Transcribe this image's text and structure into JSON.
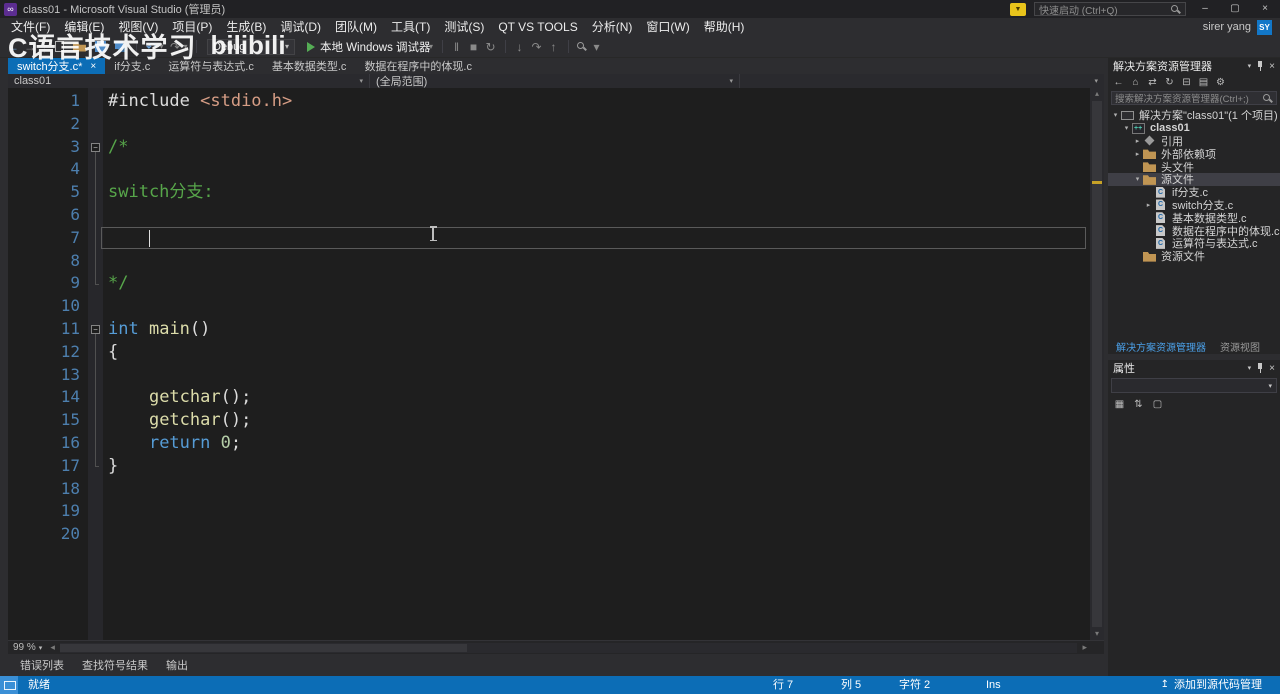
{
  "colors": {
    "accent": "#0c6db6",
    "comment": "#57a64a",
    "keyword": "#569cd6",
    "string": "#d69d85",
    "function": "#dcdcaa",
    "number": "#b5cea8",
    "linenum": "#4d7fae",
    "folder": "#c09553"
  },
  "titlebar": {
    "title": "class01 - Microsoft Visual Studio (管理员)",
    "quick_launch_placeholder": "快速启动 (Ctrl+Q)"
  },
  "user": {
    "name": "sirer yang",
    "initials": "SY"
  },
  "menubar": {
    "items": [
      "文件(F)",
      "编辑(E)",
      "视图(V)",
      "项目(P)",
      "生成(B)",
      "调试(D)",
      "团队(M)",
      "工具(T)",
      "测试(S)",
      "QT VS TOOLS",
      "分析(N)",
      "窗口(W)",
      "帮助(H)"
    ]
  },
  "watermark": {
    "title": "C语言技术学习",
    "logo": "bilibili"
  },
  "toolbar": {
    "config": "Debug",
    "run_button": "本地 Windows 调试器",
    "left_icons": [
      {
        "name": "back-icon",
        "glyph": "←",
        "cls": "c-blue"
      },
      {
        "name": "forward-icon",
        "glyph": "→",
        "cls": "c-dim"
      },
      {
        "name": "separator",
        "cls": "sep"
      },
      {
        "name": "new-file-icon",
        "cls": "i-page"
      },
      {
        "name": "open-folder-icon",
        "cls": "i-folder"
      },
      {
        "name": "save-icon",
        "cls": "i-save"
      },
      {
        "name": "save-all-icon",
        "cls": "i-saveall"
      },
      {
        "name": "separator",
        "cls": "sep"
      },
      {
        "name": "undo-icon",
        "glyph": "↶",
        "cls": "c-blue"
      },
      {
        "name": "dropdown-arrow-icon",
        "glyph": "▾",
        "cls": "c-dim sm"
      },
      {
        "name": "redo-icon",
        "glyph": "↷",
        "cls": "c-dim"
      },
      {
        "name": "dropdown-arrow-icon",
        "glyph": "▾",
        "cls": "c-dim sm"
      },
      {
        "name": "separator",
        "cls": "sep"
      }
    ],
    "debug_icons": [
      {
        "name": "run-dropdown-arrow-icon",
        "glyph": "▾",
        "cls": "c-dim sm"
      },
      {
        "name": "separator",
        "cls": "sep"
      },
      {
        "name": "pause-icon",
        "glyph": "‖",
        "cls": "c-dim"
      },
      {
        "name": "stop-icon",
        "glyph": "■",
        "cls": "c-dim"
      },
      {
        "name": "restart-icon",
        "glyph": "↻",
        "cls": "c-dim"
      },
      {
        "name": "separator",
        "cls": "sep"
      },
      {
        "name": "step-into-icon",
        "glyph": "↓",
        "cls": "c-dim"
      },
      {
        "name": "step-over-icon",
        "glyph": "↷",
        "cls": "c-dim"
      },
      {
        "name": "step-out-icon",
        "glyph": "↑",
        "cls": "c-dim"
      },
      {
        "name": "separator",
        "cls": "sep"
      },
      {
        "name": "find-icon",
        "cls": "i-mag"
      },
      {
        "name": "overflow-icon",
        "glyph": "▾",
        "cls": "c-dim"
      }
    ]
  },
  "tabs": [
    {
      "label": "switch分支.c*",
      "active": true
    },
    {
      "label": "if分支.c"
    },
    {
      "label": "运算符与表达式.c"
    },
    {
      "label": "基本数据类型.c"
    },
    {
      "label": "数据在程序中的体现.c"
    }
  ],
  "navbar": {
    "project": "class01",
    "scope": "(全局范围)"
  },
  "editor": {
    "zoom": "99 %",
    "caret": {
      "line": 7,
      "col": 5
    },
    "lines": [
      {
        "n": 1,
        "segs": [
          [
            "plain",
            "#include "
          ],
          [
            "str",
            "<stdio.h>"
          ]
        ]
      },
      {
        "n": 2,
        "segs": []
      },
      {
        "n": 3,
        "collapse": true,
        "segs": [
          [
            "com",
            "/*"
          ]
        ]
      },
      {
        "n": 4,
        "segs": []
      },
      {
        "n": 5,
        "segs": [
          [
            "com",
            "switch分支:"
          ]
        ]
      },
      {
        "n": 6,
        "segs": []
      },
      {
        "n": 7,
        "current": true,
        "segs": []
      },
      {
        "n": 8,
        "segs": []
      },
      {
        "n": 9,
        "segs": [
          [
            "com",
            "*/"
          ]
        ]
      },
      {
        "n": 10,
        "segs": []
      },
      {
        "n": 11,
        "collapse": true,
        "segs": [
          [
            "kw",
            "int"
          ],
          [
            "plain",
            " "
          ],
          [
            "fn",
            "main"
          ],
          [
            "plain",
            "()"
          ]
        ]
      },
      {
        "n": 12,
        "segs": [
          [
            "plain",
            "{"
          ]
        ]
      },
      {
        "n": 13,
        "segs": []
      },
      {
        "n": 14,
        "segs": [
          [
            "plain",
            "    "
          ],
          [
            "fn",
            "getchar"
          ],
          [
            "plain",
            "();"
          ]
        ]
      },
      {
        "n": 15,
        "segs": [
          [
            "plain",
            "    "
          ],
          [
            "fn",
            "getchar"
          ],
          [
            "plain",
            "();"
          ]
        ]
      },
      {
        "n": 16,
        "segs": [
          [
            "plain",
            "    "
          ],
          [
            "kw",
            "return"
          ],
          [
            "plain",
            " "
          ],
          [
            "num",
            "0"
          ],
          [
            "plain",
            ";"
          ]
        ]
      },
      {
        "n": 17,
        "segs": [
          [
            "plain",
            "}"
          ]
        ]
      },
      {
        "n": 18,
        "segs": []
      },
      {
        "n": 19,
        "segs": []
      },
      {
        "n": 20,
        "segs": []
      }
    ]
  },
  "solution_explorer": {
    "title": "解决方案资源管理器",
    "search_placeholder": "搜索解决方案资源管理器(Ctrl+;)",
    "toolbar_icons": [
      {
        "name": "back-icon",
        "glyph": "←"
      },
      {
        "name": "home-icon",
        "glyph": "⌂"
      },
      {
        "name": "switch-views-icon",
        "glyph": "⇄"
      },
      {
        "name": "refresh-icon",
        "glyph": "↻"
      },
      {
        "name": "collapse-all-icon",
        "glyph": "⊟"
      },
      {
        "name": "show-all-files-icon",
        "glyph": "▤"
      },
      {
        "name": "properties-icon",
        "glyph": "⚙"
      }
    ],
    "tree": [
      {
        "label": "解决方案\"class01\"(1 个项目)",
        "icon": "solution",
        "arrow": "open",
        "indent": 0
      },
      {
        "label": "class01",
        "icon": "project",
        "arrow": "open",
        "indent": 1,
        "bold": true
      },
      {
        "label": "引用",
        "icon": "references",
        "arrow": "closed",
        "indent": 2
      },
      {
        "label": "外部依赖项",
        "icon": "folder",
        "arrow": "closed",
        "indent": 2
      },
      {
        "label": "头文件",
        "icon": "folder",
        "indent": 2
      },
      {
        "label": "源文件",
        "icon": "folder",
        "arrow": "open",
        "indent": 2,
        "selected": true
      },
      {
        "label": "if分支.c",
        "icon": "cfile",
        "indent": 3
      },
      {
        "label": "switch分支.c",
        "icon": "cfile",
        "arrow": "closed",
        "indent": 3
      },
      {
        "label": "基本数据类型.c",
        "icon": "cfile",
        "indent": 3
      },
      {
        "label": "数据在程序中的体现.c",
        "icon": "cfile",
        "indent": 3
      },
      {
        "label": "运算符与表达式.c",
        "icon": "cfile",
        "indent": 3
      },
      {
        "label": "资源文件",
        "icon": "folder",
        "indent": 2
      }
    ],
    "bottom_tabs": [
      {
        "label": "解决方案资源管理器",
        "active": true
      },
      {
        "label": "资源视图"
      }
    ]
  },
  "properties_panel": {
    "title": "属性",
    "toolbar_icons": [
      {
        "name": "categorized-icon",
        "glyph": "▦"
      },
      {
        "name": "alphabetical-icon",
        "glyph": "⇅"
      },
      {
        "name": "property-pages-icon",
        "glyph": "▢"
      }
    ]
  },
  "bottom_panel_tabs": [
    "错误列表",
    "查找符号结果",
    "输出"
  ],
  "statusbar": {
    "ready": "就绪",
    "line": "行 7",
    "col": "列 5",
    "char": "字符 2",
    "mode": "Ins",
    "source_control": "添加到源代码管理"
  }
}
